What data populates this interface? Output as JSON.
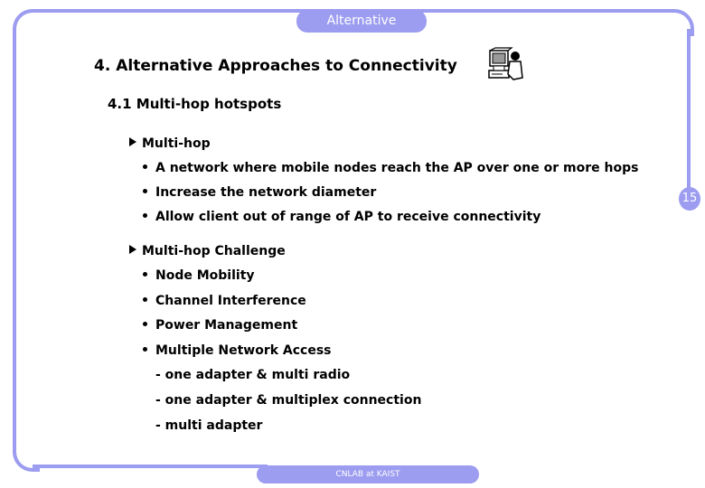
{
  "header": {
    "tab_label": "Alternative"
  },
  "slide": {
    "title": "4. Alternative Approaches to Connectivity",
    "subtitle": "4.1 Multi-hop hotspots",
    "icon": "computer-user-icon",
    "sections": [
      {
        "heading": "Multi-hop",
        "bullets": [
          "A network where mobile nodes reach the AP over one or more hops",
          "Increase the network diameter",
          "Allow client out of range of AP to receive connectivity"
        ]
      },
      {
        "heading": "Multi-hop Challenge",
        "bullets": [
          "Node Mobility",
          "Channel Interference",
          "Power Management",
          "Multiple Network Access"
        ],
        "sub_items": [
          "- one adapter & multi radio",
          "- one adapter & multiplex connection",
          "- multi adapter"
        ]
      }
    ]
  },
  "page_number": "15",
  "footer": {
    "label": "CNLAB at KAIST"
  },
  "colors": {
    "accent": "#9c9cf0",
    "text": "#000000",
    "background": "#ffffff"
  }
}
